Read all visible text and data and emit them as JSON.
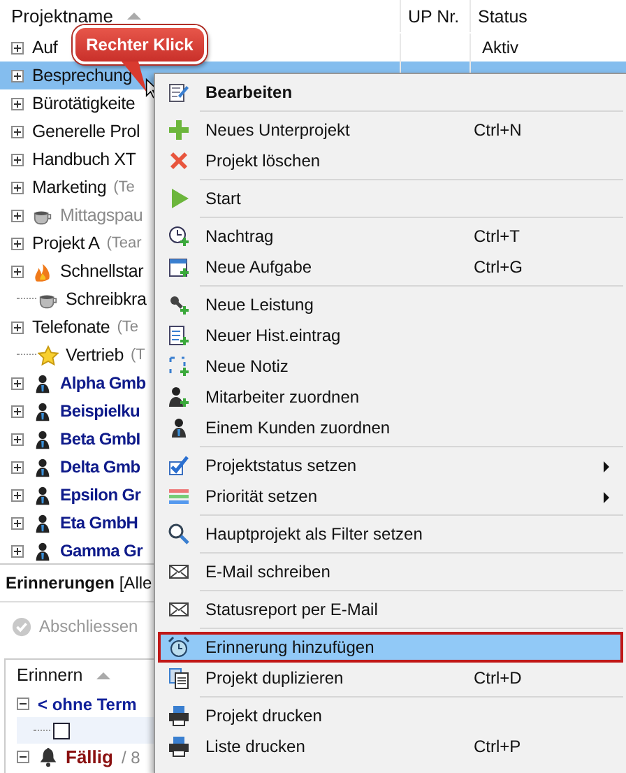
{
  "tree": {
    "columns": [
      "Projektname",
      "UP Nr.",
      "Status"
    ],
    "rows": [
      {
        "label": "Auf",
        "kind": "folder",
        "expandable": true,
        "muted": false,
        "selected": false,
        "status": "Aktiv"
      },
      {
        "label": "Besprechung",
        "kind": "folder",
        "expandable": true,
        "muted": false,
        "selected": true
      },
      {
        "label": "Bürotätigkeite",
        "kind": "folder",
        "expandable": true,
        "muted": false,
        "selected": false
      },
      {
        "label": "Generelle Prol",
        "kind": "folder",
        "expandable": true,
        "muted": false,
        "selected": false
      },
      {
        "label": "Handbuch XT",
        "kind": "folder",
        "expandable": true,
        "muted": false,
        "selected": false
      },
      {
        "label": "Marketing",
        "tag": "(Te",
        "kind": "folder",
        "expandable": true,
        "muted": false,
        "selected": false
      },
      {
        "label": "Mittagspau",
        "kind": "cup",
        "expandable": true,
        "muted": true,
        "selected": false
      },
      {
        "label": "Projekt A",
        "tag": "(Tear",
        "kind": "folder",
        "expandable": true,
        "muted": false,
        "selected": false
      },
      {
        "label": "Schnellstar",
        "kind": "flame",
        "expandable": true,
        "muted": false,
        "selected": false
      },
      {
        "label": "Schreibkra",
        "kind": "cup",
        "expandable": false,
        "muted": false,
        "selected": false
      },
      {
        "label": "Telefonate",
        "tag": "(Te",
        "kind": "folder",
        "expandable": true,
        "muted": false,
        "selected": false
      },
      {
        "label": "Vertrieb",
        "tag": "(T",
        "kind": "star",
        "expandable": false,
        "muted": false,
        "selected": false
      },
      {
        "label": "Alpha Gmb",
        "kind": "customer",
        "expandable": true,
        "muted": false,
        "selected": false
      },
      {
        "label": "Beispielku",
        "kind": "customer",
        "expandable": true,
        "muted": false,
        "selected": false
      },
      {
        "label": "Beta GmbI",
        "kind": "customer",
        "expandable": true,
        "muted": false,
        "selected": false
      },
      {
        "label": "Delta Gmb",
        "kind": "customer",
        "expandable": true,
        "muted": false,
        "selected": false
      },
      {
        "label": "Epsilon Gr",
        "kind": "customer",
        "expandable": true,
        "muted": false,
        "selected": false
      },
      {
        "label": "Eta GmbH",
        "kind": "customer",
        "expandable": true,
        "muted": false,
        "selected": false
      },
      {
        "label": "Gamma Gr",
        "kind": "customer",
        "expandable": true,
        "muted": false,
        "selected": false
      }
    ]
  },
  "callout": "Rechter Klick",
  "reminders": {
    "title": "**Erinnerungen** [Alle",
    "button": {
      "label": "Abschliessen",
      "disabled": true
    },
    "column": "Erinnern",
    "rows": [
      {
        "kind": "group",
        "label": "< ohne Term",
        "expanded": true
      },
      {
        "kind": "check",
        "checked": false
      },
      {
        "kind": "due",
        "label": "Fällig",
        "count": "/ 8",
        "expanded": true
      }
    ]
  },
  "menu": {
    "items": [
      {
        "label": "Bearbeiten",
        "bold": true,
        "separator_before": false,
        "selected": false,
        "submenu": false
      },
      {
        "label": "Neues Unterprojekt",
        "shortcut": "Ctrl+N",
        "bold": false,
        "separator_before": true,
        "selected": false,
        "submenu": false
      },
      {
        "label": "Projekt löschen",
        "bold": false,
        "separator_before": false,
        "selected": false,
        "submenu": false
      },
      {
        "label": "Start",
        "bold": false,
        "separator_before": true,
        "selected": false,
        "submenu": false
      },
      {
        "label": "Nachtrag",
        "shortcut": "Ctrl+T",
        "bold": false,
        "separator_before": true,
        "selected": false,
        "submenu": false
      },
      {
        "label": "Neue Aufgabe",
        "shortcut": "Ctrl+G",
        "bold": false,
        "separator_before": false,
        "selected": false,
        "submenu": false
      },
      {
        "label": "Neue Leistung",
        "bold": false,
        "separator_before": true,
        "selected": false,
        "submenu": false
      },
      {
        "label": "Neuer Hist.eintrag",
        "bold": false,
        "separator_before": false,
        "selected": false,
        "submenu": false
      },
      {
        "label": "Neue Notiz",
        "bold": false,
        "separator_before": false,
        "selected": false,
        "submenu": false
      },
      {
        "label": "Mitarbeiter zuordnen",
        "bold": false,
        "separator_before": false,
        "selected": false,
        "submenu": false
      },
      {
        "label": "Einem Kunden zuordnen",
        "bold": false,
        "separator_before": false,
        "selected": false,
        "submenu": false
      },
      {
        "label": "Projektstatus setzen",
        "bold": false,
        "separator_before": true,
        "selected": false,
        "submenu": true
      },
      {
        "label": "Priorität setzen",
        "bold": false,
        "separator_before": false,
        "selected": false,
        "submenu": true
      },
      {
        "label": "Hauptprojekt als Filter setzen",
        "bold": false,
        "separator_before": true,
        "selected": false,
        "submenu": false
      },
      {
        "label": "E-Mail schreiben",
        "bold": false,
        "separator_before": true,
        "selected": false,
        "submenu": false
      },
      {
        "label": "Statusreport per E-Mail",
        "bold": false,
        "separator_before": true,
        "selected": false,
        "submenu": false
      },
      {
        "label": "Erinnerung hinzufügen",
        "bold": false,
        "separator_before": true,
        "selected": true,
        "submenu": false
      },
      {
        "label": "Projekt duplizieren",
        "shortcut": "Ctrl+D",
        "bold": false,
        "separator_before": false,
        "selected": false,
        "submenu": false
      },
      {
        "label": "Projekt drucken",
        "bold": false,
        "separator_before": true,
        "selected": false,
        "submenu": false
      },
      {
        "label": "Liste drucken",
        "shortcut": "Ctrl+P",
        "bold": false,
        "separator_before": false,
        "selected": false,
        "submenu": false
      }
    ]
  }
}
